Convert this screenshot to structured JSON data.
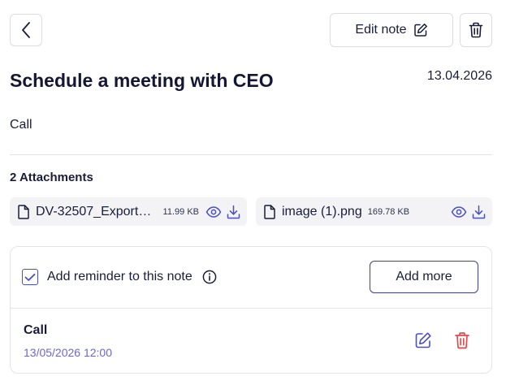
{
  "toolbar": {
    "edit_label": "Edit note"
  },
  "note": {
    "title": "Schedule a meeting with CEO",
    "date": "13.04.2026",
    "body": "Call"
  },
  "attachments": {
    "heading": "2 Attachments",
    "items": [
      {
        "name": "DV-32507_Export_2...",
        "size": "11.99 KB"
      },
      {
        "name": "image (1).png",
        "size": "169.78 KB"
      }
    ]
  },
  "reminder": {
    "checkbox_label": "Add reminder to this note",
    "checked": true,
    "add_more_label": "Add more",
    "items": [
      {
        "title": "Call",
        "datetime": "13/05/2026 12:00"
      }
    ]
  },
  "colors": {
    "accent": "#4a4fc4",
    "reminder_date": "#6a66d4",
    "danger": "#e5484d",
    "text": "#1a1d3a"
  },
  "icons": {
    "back": "chevron-left-icon",
    "edit": "pencil-square-icon",
    "delete": "trash-icon",
    "file": "file-icon",
    "preview": "eye-icon",
    "download": "download-icon",
    "info": "info-circle-icon",
    "check": "check-icon"
  }
}
